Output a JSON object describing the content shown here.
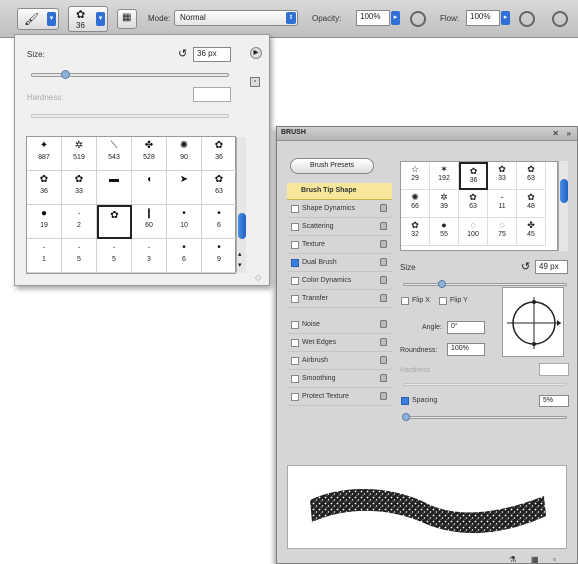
{
  "options_bar": {
    "brush_size": "36",
    "mode_label": "Mode:",
    "mode_value": "Normal",
    "opacity_label": "Opacity:",
    "opacity_value": "100%",
    "flow_label": "Flow:",
    "flow_value": "100%"
  },
  "picker": {
    "size_label": "Size:",
    "size_value": "36 px",
    "hardness_label": "Hardness:",
    "brushes": [
      {
        "glyph": "✦",
        "num": "887"
      },
      {
        "glyph": "✲",
        "num": "519"
      },
      {
        "glyph": "⟍",
        "num": "543"
      },
      {
        "glyph": "✤",
        "num": "528"
      },
      {
        "glyph": "✺",
        "num": "90"
      },
      {
        "glyph": "✿",
        "num": "36"
      },
      {
        "glyph": "✿",
        "num": "36"
      },
      {
        "glyph": "✿",
        "num": "33"
      },
      {
        "glyph": "▬",
        "num": ""
      },
      {
        "glyph": "◖",
        "num": ""
      },
      {
        "glyph": "➤",
        "num": ""
      },
      {
        "glyph": "✿",
        "num": "63"
      },
      {
        "glyph": "●",
        "num": "19"
      },
      {
        "glyph": "·",
        "num": "2"
      },
      {
        "glyph": "✿",
        "num": ""
      },
      {
        "glyph": "❙",
        "num": "60"
      },
      {
        "glyph": "•",
        "num": "10"
      },
      {
        "glyph": "•",
        "num": "6"
      },
      {
        "glyph": "·",
        "num": "1"
      },
      {
        "glyph": "·",
        "num": "5"
      },
      {
        "glyph": "·",
        "num": "5"
      },
      {
        "glyph": "·",
        "num": "3"
      },
      {
        "glyph": "•",
        "num": "6"
      },
      {
        "glyph": "•",
        "num": "9"
      }
    ]
  },
  "panel": {
    "title": "BRUSH",
    "presets_button": "Brush Presets",
    "options": [
      {
        "label": "Brush Tip Shape",
        "checked": null,
        "active": true
      },
      {
        "label": "Shape Dynamics",
        "checked": false
      },
      {
        "label": "Scattering",
        "checked": false
      },
      {
        "label": "Texture",
        "checked": false
      },
      {
        "label": "Dual Brush",
        "checked": true
      },
      {
        "label": "Color Dynamics",
        "checked": false
      },
      {
        "label": "Transfer",
        "checked": false
      },
      {
        "label": "Noise",
        "checked": false
      },
      {
        "label": "Wet Edges",
        "checked": false
      },
      {
        "label": "Airbrush",
        "checked": false
      },
      {
        "label": "Smoothing",
        "checked": false
      },
      {
        "label": "Protect Texture",
        "checked": false
      }
    ],
    "tips": [
      {
        "glyph": "☆",
        "num": "29"
      },
      {
        "glyph": "✶",
        "num": "192"
      },
      {
        "glyph": "✿",
        "num": "36"
      },
      {
        "glyph": "✿",
        "num": "33"
      },
      {
        "glyph": "✿",
        "num": "63"
      },
      {
        "glyph": "✺",
        "num": "66"
      },
      {
        "glyph": "✲",
        "num": "39"
      },
      {
        "glyph": "✿",
        "num": "63"
      },
      {
        "glyph": "-",
        "num": "11"
      },
      {
        "glyph": "✿",
        "num": "48"
      },
      {
        "glyph": "✿",
        "num": "32"
      },
      {
        "glyph": "●",
        "num": "55"
      },
      {
        "glyph": "◌",
        "num": "100"
      },
      {
        "glyph": "◌",
        "num": "75"
      },
      {
        "glyph": "✤",
        "num": "45"
      }
    ],
    "size_label": "Size",
    "size_value": "49 px",
    "flip_x": "Flip X",
    "flip_y": "Flip Y",
    "angle_label": "Angle:",
    "angle_value": "0°",
    "roundness_label": "Roundness:",
    "roundness_value": "100%",
    "hardness_label": "Hardness",
    "spacing_label": "Spacing",
    "spacing_value": "5%"
  }
}
